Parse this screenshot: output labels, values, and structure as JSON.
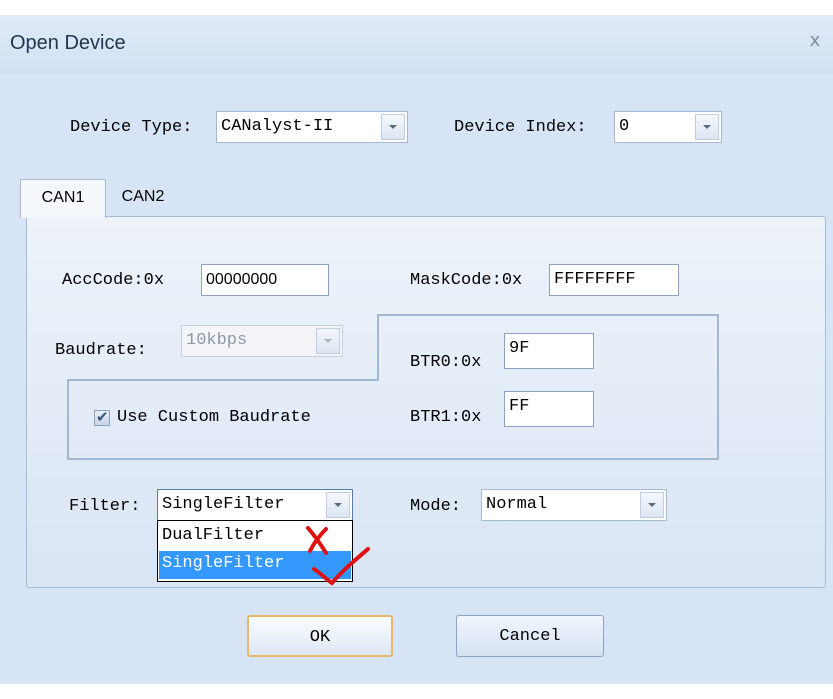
{
  "dialog": {
    "title": "Open Device",
    "close_glyph": "x"
  },
  "device": {
    "type_label": "Device Type:",
    "type_value": "CANalyst-II",
    "index_label": "Device Index:",
    "index_value": "0"
  },
  "tabs": [
    {
      "label": "CAN1",
      "active": true
    },
    {
      "label": "CAN2",
      "active": false
    }
  ],
  "can": {
    "acccode_label": "AccCode:0x",
    "acccode_value": "00000000",
    "maskcode_label": "MaskCode:0x",
    "maskcode_value": "FFFFFFFF",
    "baudrate_label": "Baudrate:",
    "baudrate_value": "10kbps",
    "btr0_label": "BTR0:0x",
    "btr0_value": "9F",
    "btr1_label": "BTR1:0x",
    "btr1_value": "FF",
    "custom_baud_label": "Use Custom Baudrate",
    "custom_baud_checked": true,
    "filter_label": "Filter:",
    "filter_value": "SingleFilter",
    "filter_options": [
      "DualFilter",
      "SingleFilter"
    ],
    "filter_selected_index": 1,
    "mode_label": "Mode:",
    "mode_value": "Normal"
  },
  "buttons": {
    "ok": "OK",
    "cancel": "Cancel"
  },
  "annotations": {
    "cross_color": "#e01010",
    "tick_color": "#e01010"
  },
  "colors": {
    "dialog_bg": "#d6e4f5",
    "selection": "#3399ff",
    "default_button_border": "#e7b86a"
  }
}
